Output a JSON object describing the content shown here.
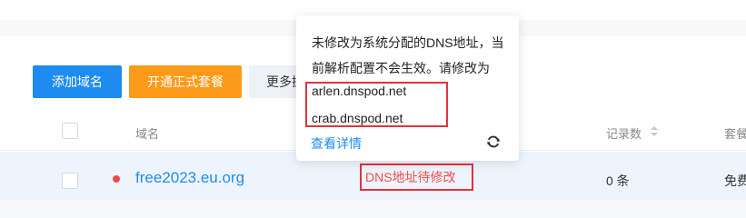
{
  "toolbar": {
    "add_domain_label": "添加域名",
    "open_package_label": "开通正式套餐",
    "more_label": "更多操作"
  },
  "table": {
    "headers": {
      "domain": "域名",
      "record_count": "记录数",
      "plan": "套餐"
    },
    "rows": [
      {
        "domain": "free2023.eu.org",
        "status": "DNS地址待修改",
        "record_count": "0 条",
        "plan": "免费版"
      }
    ]
  },
  "popover": {
    "message": "未修改为系统分配的DNS地址，当前解析配置不会生效。请修改为",
    "nameservers": [
      "arlen.dnspod.net",
      "crab.dnspod.net"
    ],
    "detail_link": "查看详情",
    "refresh_icon": "refresh-icon"
  },
  "colors": {
    "primary": "#1e8bf0",
    "orange": "#fe9a1a",
    "error": "#ef4b4b",
    "annotation_red": "#e2323a",
    "row_highlight": "#eef4fd"
  }
}
